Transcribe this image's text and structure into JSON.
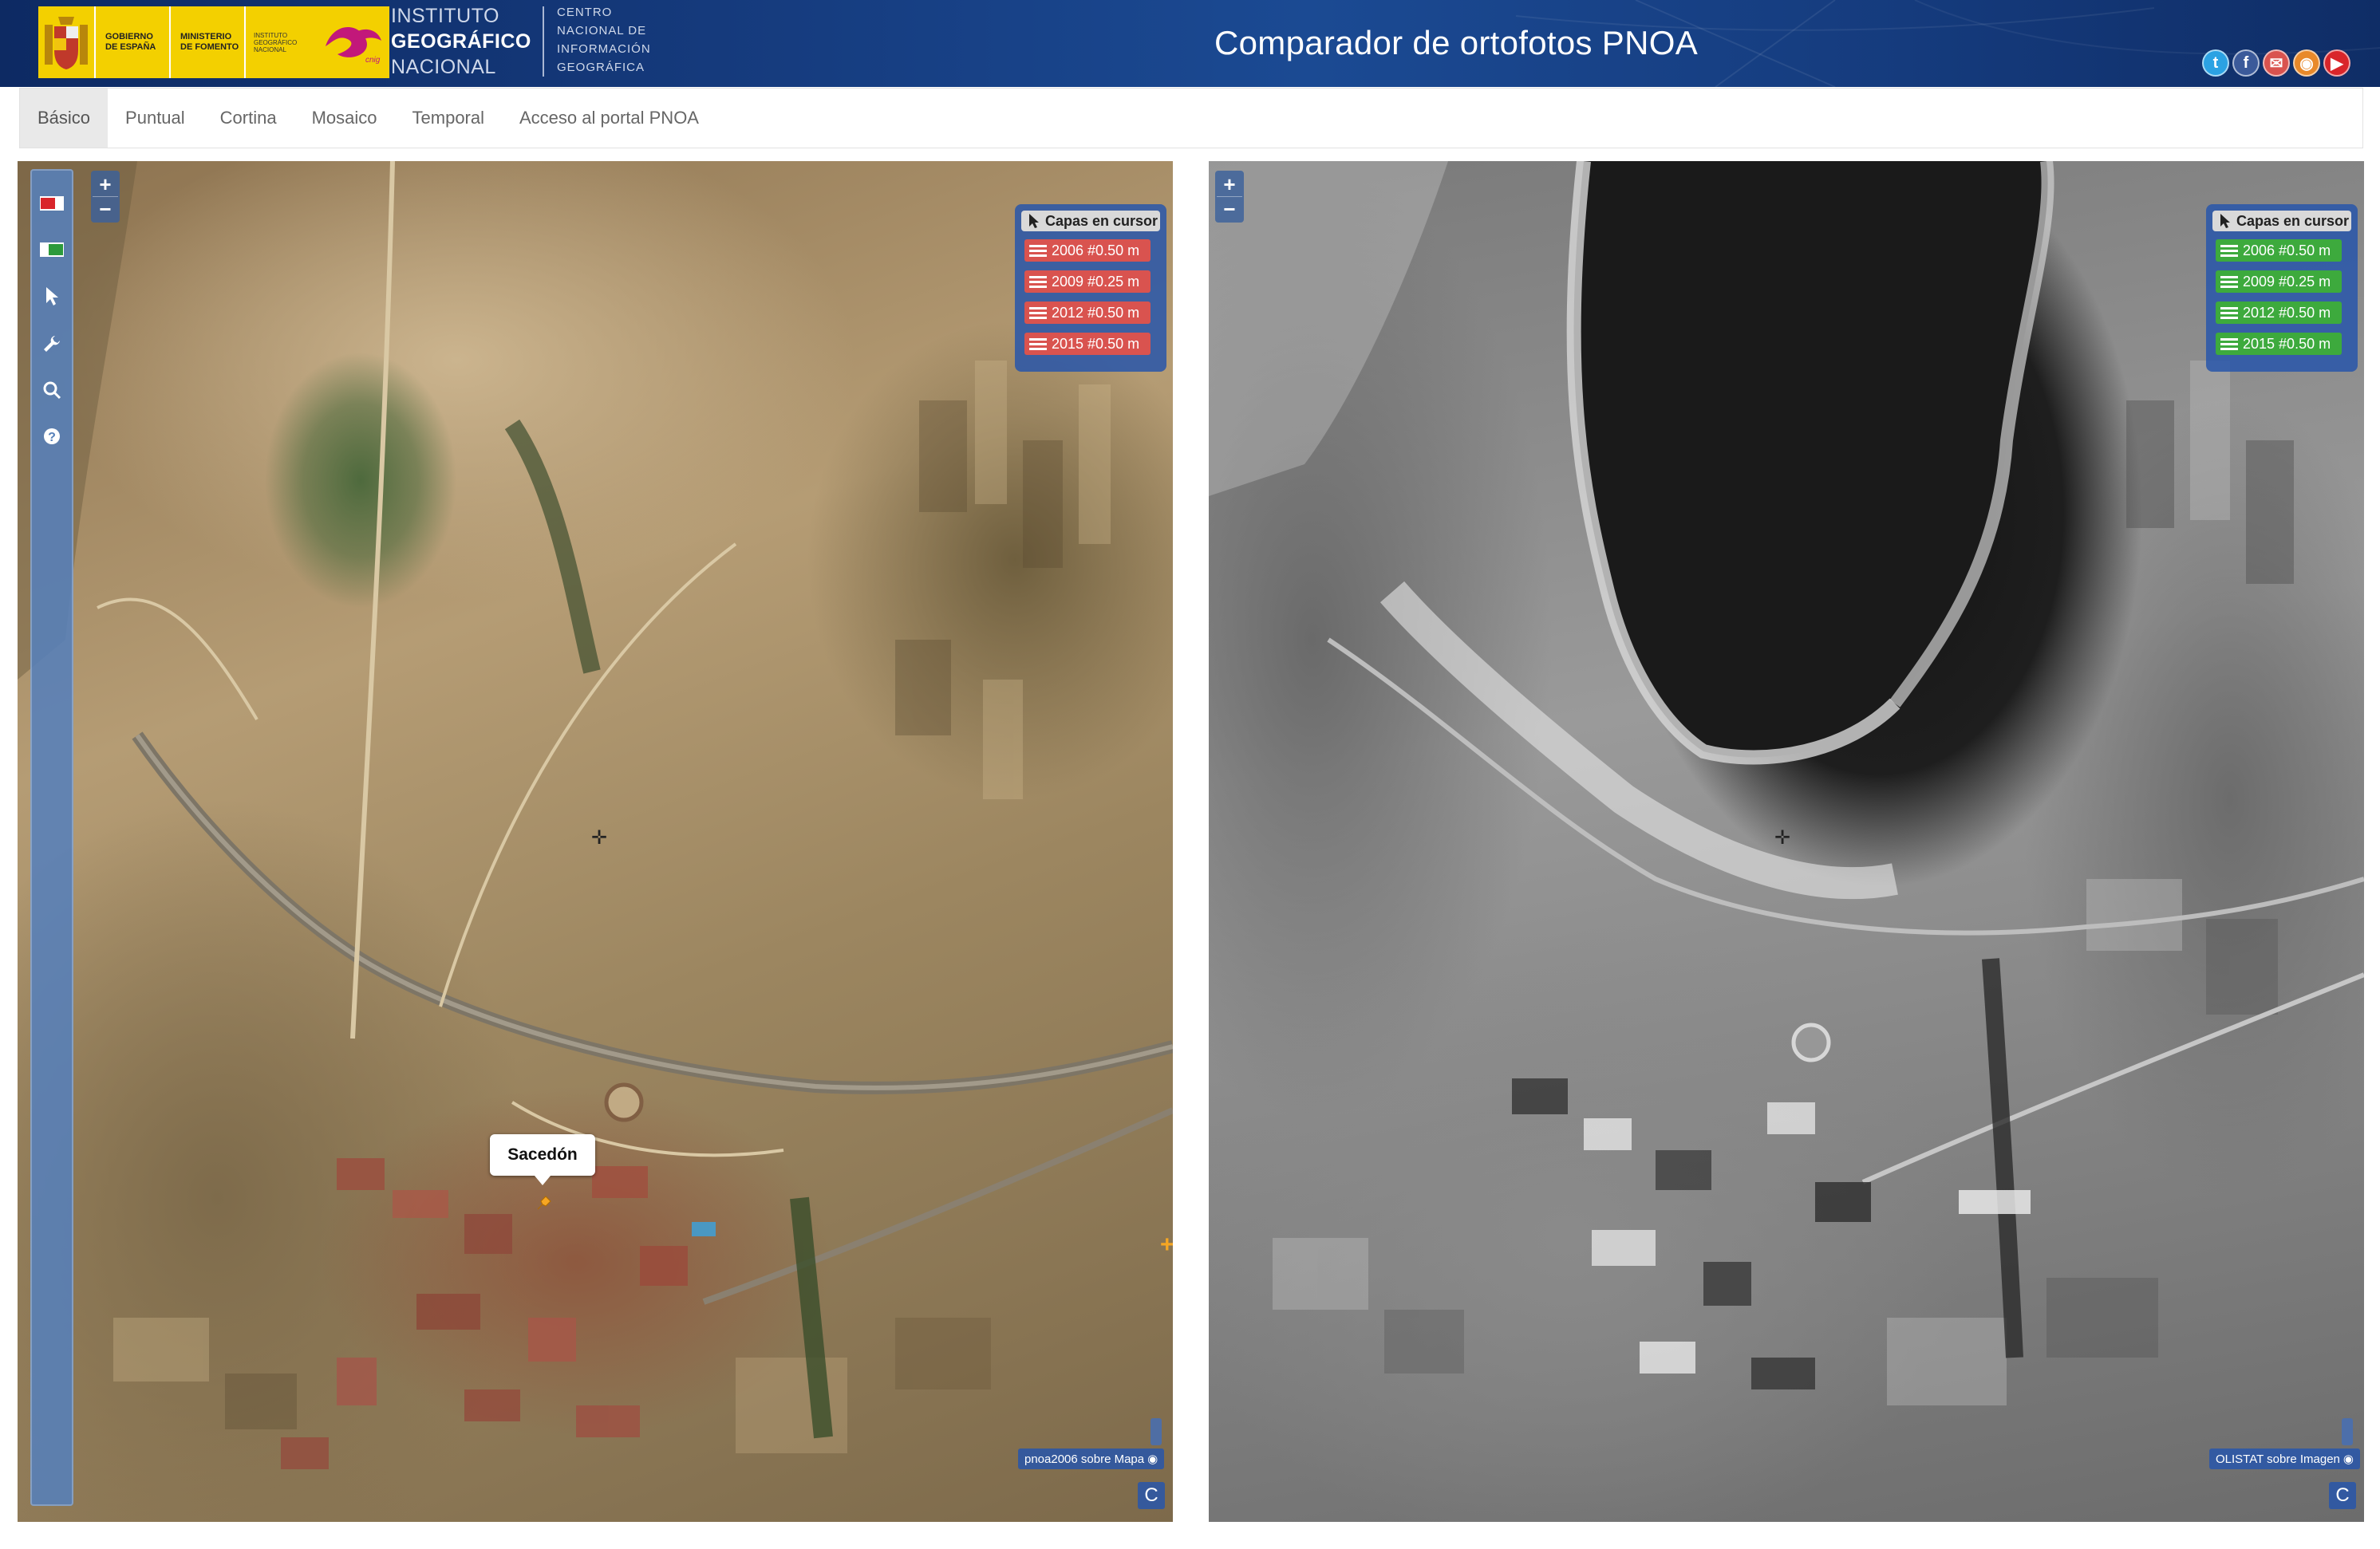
{
  "header": {
    "gov_line1": "GOBIERNO",
    "gov_line2": "DE ESPAÑA",
    "min_line1": "MINISTERIO",
    "min_line2": "DE FOMENTO",
    "ign_mini": "INSTITUTO GEOGRÁFICO NACIONAL",
    "ign_line1": "INSTITUTO",
    "ign_line2": "GEOGRÁFICO",
    "ign_line3": "NACIONAL",
    "cnig_line1": "CENTRO",
    "cnig_line2": "NACIONAL DE",
    "cnig_line3": "INFORMACIÓN",
    "cnig_line4": "GEOGRÁFICA",
    "title": "Comparador de ortofotos PNOA",
    "social_icons": [
      "twitter-icon",
      "facebook-icon",
      "mail-icon",
      "rss-icon",
      "youtube-icon"
    ],
    "social_glyphs": [
      "t",
      "f",
      "✉",
      "◉",
      "▶"
    ],
    "social_colors": [
      "#2ba2e3",
      "#3b5a9a",
      "#d9534f",
      "#e8892a",
      "#d9252a"
    ]
  },
  "nav": {
    "items": [
      "Básico",
      "Puntual",
      "Cortina",
      "Mosaico",
      "Temporal",
      "Acceso al portal PNOA"
    ],
    "active": "Básico"
  },
  "left_map": {
    "zoom_in": "+",
    "zoom_out": "−",
    "layers_title": "Capas en cursor",
    "layers": [
      "2006 #0.50 m",
      "2009 #0.25 m",
      "2012 #0.50 m",
      "2015 #0.50 m"
    ],
    "layer_color": "#d9534f",
    "attribution": "pnoa2006 sobre Mapa",
    "corner_button": "C",
    "place_label": "Sacedón",
    "tools": [
      "red-layer-icon",
      "green-layer-icon",
      "pointer-icon",
      "wrench-icon",
      "search-icon",
      "help-icon"
    ]
  },
  "right_map": {
    "zoom_in": "+",
    "zoom_out": "−",
    "layers_title": "Capas en cursor",
    "layers": [
      "2006 #0.50 m",
      "2009 #0.25 m",
      "2012 #0.50 m",
      "2015 #0.50 m"
    ],
    "layer_color": "#3daa3d",
    "attribution": "OLISTAT sobre Imagen",
    "corner_button": "C"
  }
}
